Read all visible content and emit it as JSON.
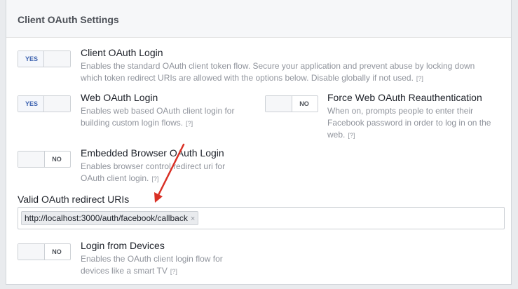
{
  "panel": {
    "title": "Client OAuth Settings"
  },
  "settings": {
    "client_oauth": {
      "title": "Client OAuth Login",
      "desc_line1": "Enables the standard OAuth client token flow. Secure your application and prevent abuse by locking down",
      "desc_line2": "which token redirect URIs are allowed with the options below. Disable globally if not used.",
      "help": "[?]",
      "toggle": "YES"
    },
    "web_oauth": {
      "title": "Web OAuth Login",
      "desc_line1": "Enables web based OAuth client login for",
      "desc_line2": "building custom login flows.",
      "help": "[?]",
      "toggle": "YES"
    },
    "force_reauth": {
      "title": "Force Web OAuth Reauthentication",
      "desc_line1": "When on, prompts people to enter their",
      "desc_line2": "Facebook password in order to log in on the",
      "desc_line3": "web.",
      "help": "[?]",
      "toggle": "NO"
    },
    "embedded_browser": {
      "title": "Embedded Browser OAuth Login",
      "desc_line1": "Enables browser control redirect uri for",
      "desc_line2": "OAuth client login.",
      "help": "[?]",
      "toggle": "NO"
    },
    "devices": {
      "title": "Login from Devices",
      "desc_line1": "Enables the OAuth client login flow for",
      "desc_line2": "devices like a smart TV",
      "help": "[?]",
      "toggle": "NO"
    }
  },
  "redirect_uris": {
    "label": "Valid OAuth redirect URIs",
    "tokens": [
      "http://localhost:3000/auth/facebook/callback"
    ],
    "remove_glyph": "×"
  },
  "colors": {
    "accent": "#4267b2",
    "annotation_arrow": "#d93025"
  }
}
